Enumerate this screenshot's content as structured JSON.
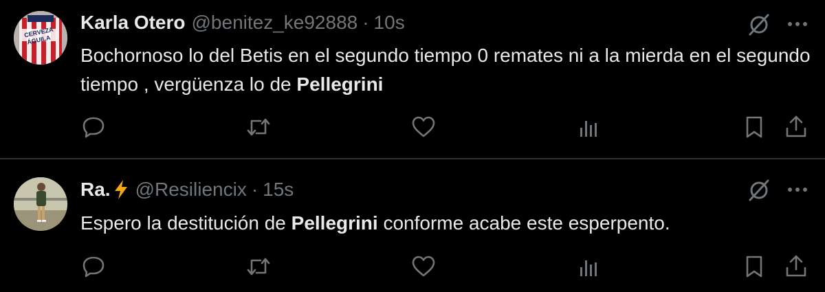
{
  "tweets": [
    {
      "author_name": "Karla Otero",
      "handle": "@benitez_ke92888",
      "separator": "·",
      "time": "10s",
      "text_before": "Bochornoso lo del Betis en el segundo tiempo 0 remates ni a la mierda en el segundo tiempo , vergüenza lo de ",
      "text_bold": "Pellegrini",
      "text_after": "",
      "avatar_text_1": "CERVEZA",
      "avatar_text_2": "ÁGUILA"
    },
    {
      "author_name": "Ra.",
      "author_emoji": "lightning-bolt",
      "handle": "@Resiliencix",
      "separator": "·",
      "time": "15s",
      "text_before": "Espero la destitución de ",
      "text_bold": "Pellegrini",
      "text_after": " conforme acabe este esperpento."
    }
  ],
  "icons": {
    "header": [
      "grok-slash-icon",
      "more-icon"
    ],
    "actions": [
      "reply-icon",
      "retweet-icon",
      "like-icon",
      "views-icon",
      "bookmark-icon",
      "share-icon"
    ]
  },
  "colors": {
    "background": "#000000",
    "text": "#e7e9ea",
    "muted": "#71767b",
    "divider": "#2f3336",
    "bolt": "#f4a51c"
  }
}
